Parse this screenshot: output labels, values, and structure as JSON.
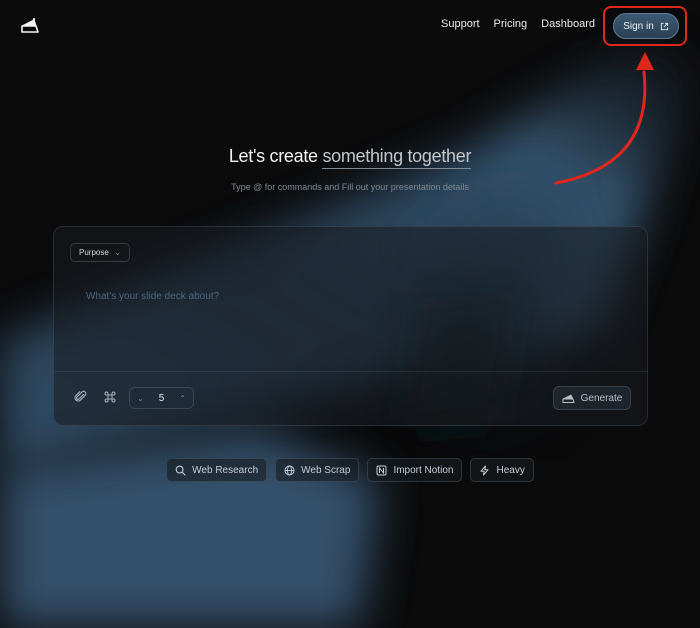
{
  "header": {
    "logo_icon": "cake-slice-icon",
    "nav": [
      "Support",
      "Pricing",
      "Dashboard"
    ],
    "signin_label": "Sign in",
    "signin_icon": "external-link-icon",
    "highlight_color": "#e0271c"
  },
  "hero": {
    "title_prefix": "Let's create",
    "title_emphasis": "something together",
    "subtitle": "Type @ for commands and Fill out your presentation details"
  },
  "composer": {
    "purpose_label": "Purpose",
    "prompt_placeholder": "What's your slide deck about?",
    "prompt_value": "",
    "attach_icon": "paperclip-icon",
    "command_icon": "command-icon",
    "slide_count": "5",
    "generate_label": "Generate",
    "generate_icon": "cake-slice-icon"
  },
  "chips": [
    {
      "label": "Web Research",
      "icon": "search-icon"
    },
    {
      "label": "Web Scrap",
      "icon": "globe-icon"
    },
    {
      "label": "Import Notion",
      "icon": "notion-icon"
    },
    {
      "label": "Heavy",
      "icon": "lightning-icon"
    }
  ],
  "colors": {
    "background": "#0b0b0c",
    "light_beam": "#3f6585",
    "accent_button": "#2f4a61"
  }
}
